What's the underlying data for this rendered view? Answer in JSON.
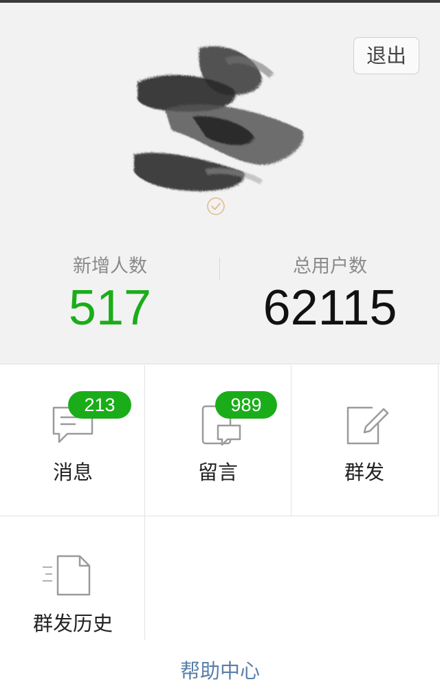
{
  "header": {
    "logout_label": "退出"
  },
  "stats": {
    "new_users_label": "新增人数",
    "new_users_value": "517",
    "total_users_label": "总用户数",
    "total_users_value": "62115"
  },
  "menu": {
    "messages": {
      "label": "消息",
      "badge": "213"
    },
    "comments": {
      "label": "留言",
      "badge": "989"
    },
    "broadcast": {
      "label": "群发"
    },
    "broadcast_history": {
      "label": "群发历史"
    }
  },
  "footer": {
    "help_label": "帮助中心"
  },
  "colors": {
    "accent_green": "#1aad19",
    "link_blue": "#5a7fa8",
    "header_bg": "#f2f2f2"
  },
  "icons": {
    "avatar": "ink-brush-avatar",
    "verified": "verified-check-icon",
    "messages": "chat-bubble-icon",
    "comments": "tablet-comment-icon",
    "broadcast": "edit-pen-icon",
    "history": "document-list-icon"
  }
}
